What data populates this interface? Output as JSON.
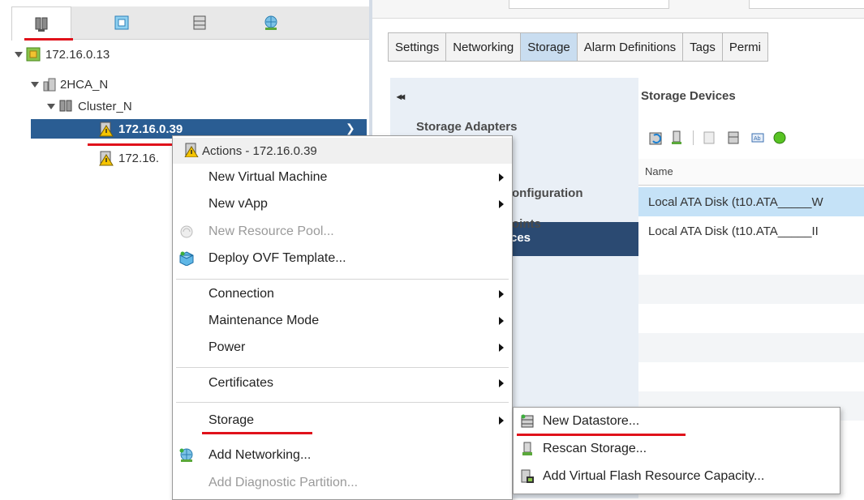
{
  "navigator": {
    "tabs": [
      {
        "icon": "hosts-clusters-icon"
      },
      {
        "icon": "vms-templates-icon"
      },
      {
        "icon": "storage-icon"
      },
      {
        "icon": "networking-icon"
      }
    ],
    "tree": [
      {
        "label": "172.16.0.13",
        "icon": "vcenter-icon"
      },
      {
        "label": "2HCA_N",
        "icon": "datacenter-icon"
      },
      {
        "label": "Cluster_N",
        "icon": "cluster-icon"
      },
      {
        "label": "172.16.0.39",
        "icon": "host-warning-icon"
      },
      {
        "label": "172.16.",
        "icon": "host-warning-icon"
      }
    ]
  },
  "tabs": [
    "Settings",
    "Networking",
    "Storage",
    "Alarm Definitions",
    "Tags",
    "Permi"
  ],
  "active_tab": "Storage",
  "storage_nav": {
    "collapse_glyph": "◂◂",
    "items": [
      "Storage Adapters",
      "ces",
      "onfiguration",
      "oints"
    ]
  },
  "storage_devices": {
    "title": "Storage Devices",
    "column_name": "Name",
    "rows": [
      "Local ATA Disk (t10.ATA_____W",
      "Local ATA Disk (t10.ATA_____II"
    ]
  },
  "actions_menu": {
    "header": "Actions - 172.16.0.39",
    "items": [
      {
        "label": "New Virtual Machine",
        "submenu": true,
        "disabled": false
      },
      {
        "label": "New vApp",
        "submenu": true,
        "disabled": false
      },
      {
        "label": "New Resource Pool...",
        "submenu": false,
        "disabled": true
      },
      {
        "label": "Deploy OVF Template...",
        "submenu": false,
        "disabled": false
      },
      {
        "label": "Connection",
        "submenu": true,
        "disabled": false
      },
      {
        "label": "Maintenance Mode",
        "submenu": true,
        "disabled": false
      },
      {
        "label": "Power",
        "submenu": true,
        "disabled": false
      },
      {
        "label": "Certificates",
        "submenu": true,
        "disabled": false
      },
      {
        "label": "Storage",
        "submenu": true,
        "disabled": false
      },
      {
        "label": "Add Networking...",
        "submenu": false,
        "disabled": false
      },
      {
        "label": "Add Diagnostic Partition...",
        "submenu": false,
        "disabled": true
      }
    ]
  },
  "storage_submenu": {
    "items": [
      "New Datastore...",
      "Rescan Storage...",
      "Add Virtual Flash Resource Capacity..."
    ]
  },
  "colors": {
    "selection": "#2a5d93",
    "highlight_underline": "#e0121b",
    "active_tab": "#c9ddf0",
    "selected_row": "#c5e2f7"
  }
}
